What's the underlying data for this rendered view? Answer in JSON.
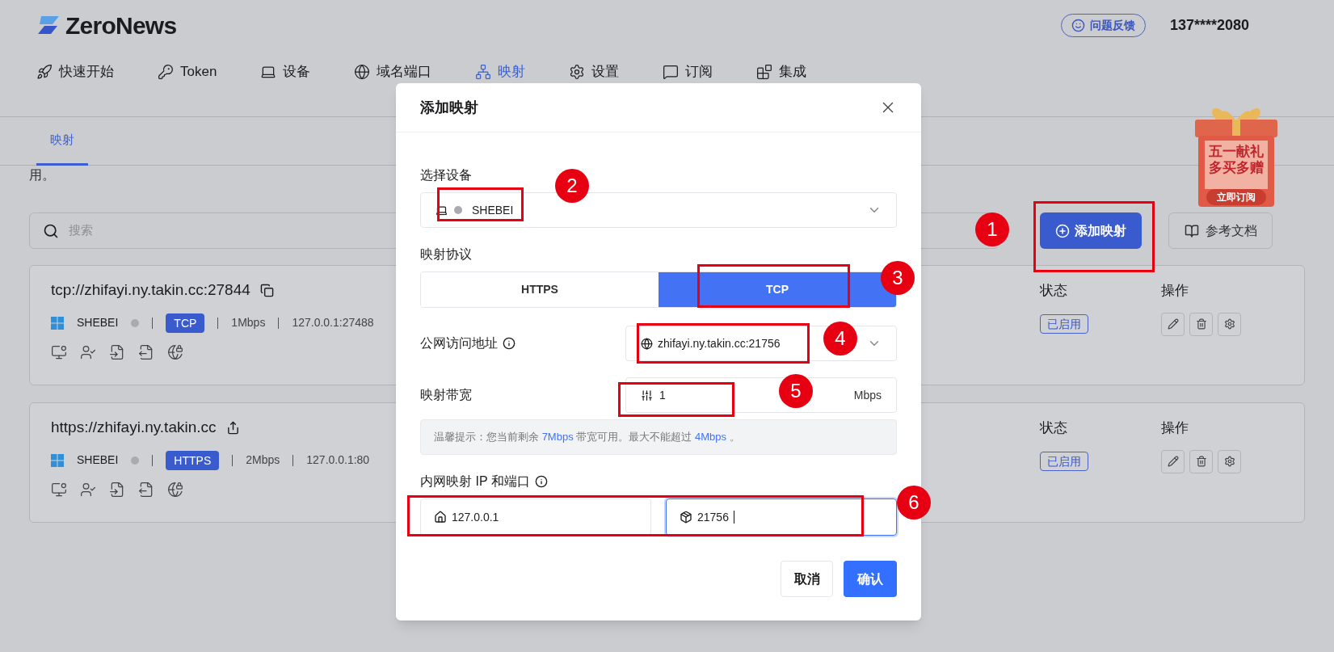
{
  "header": {
    "logo": "ZeroNews",
    "feedback": "问题反馈",
    "account": "137****2080"
  },
  "nav": [
    {
      "label": "快速开始",
      "selected": false
    },
    {
      "label": "Token",
      "selected": false
    },
    {
      "label": "设备",
      "selected": false
    },
    {
      "label": "域名端口",
      "selected": false
    },
    {
      "label": "映射",
      "selected": true
    },
    {
      "label": "设置",
      "selected": false
    },
    {
      "label": "订阅",
      "selected": false
    },
    {
      "label": "集成",
      "selected": false
    }
  ],
  "subtabs": [
    {
      "label": "映射",
      "selected": true
    }
  ],
  "notice_fragment": "用。",
  "search": {
    "placeholder": "搜索"
  },
  "toolbar": {
    "add_button": "添加映射",
    "docs_button": "参考文档"
  },
  "promo": {
    "line_1": "五一献礼",
    "line_2": "多买多赠",
    "cta": "立即订阅"
  },
  "mappings": [
    {
      "url": "tcp://zhifayi.ny.takin.cc:27844",
      "kind": "copy",
      "device": "SHEBEI",
      "device_online": false,
      "protocol": "TCP",
      "bandwidth": "1Mbps",
      "local": "127.0.0.1:27488",
      "status_header": "状态",
      "actions_header": "操作",
      "status": "已启用"
    },
    {
      "url": "https://zhifayi.ny.takin.cc",
      "kind": "share",
      "device": "SHEBEI",
      "device_online": false,
      "protocol": "HTTPS",
      "bandwidth": "2Mbps",
      "local": "127.0.0.1:80",
      "status_header": "状态",
      "actions_header": "操作",
      "status": "已启用"
    }
  ],
  "dialog": {
    "title": "添加映射",
    "device_label": "选择设备",
    "device": "SHEBEI",
    "device_online": false,
    "protocol_label": "映射协议",
    "protocols": [
      {
        "label": "HTTPS",
        "selected": false
      },
      {
        "label": "TCP",
        "selected": true
      }
    ],
    "public_label": "公网访问地址",
    "public_address": "zhifayi.ny.takin.cc:21756",
    "bandwidth_label": "映射带宽",
    "bandwidth": "1",
    "bandwidth_unit": "Mbps",
    "tip": {
      "text_1": "温馨提示：您当前剩余",
      "remaining": "7Mbps",
      "text_2": "带宽可用。最大不能超过",
      "max": "4Mbps",
      "text_3": "。"
    },
    "local_label": "内网映射 IP 和端口",
    "local_ip": "127.0.0.1",
    "local_port": "21756",
    "local_port_focused": true,
    "cancel": "取消",
    "confirm": "确认"
  },
  "annotations": [
    {
      "number": "1"
    },
    {
      "number": "2"
    },
    {
      "number": "3"
    },
    {
      "number": "4"
    },
    {
      "number": "5"
    },
    {
      "number": "6"
    }
  ]
}
